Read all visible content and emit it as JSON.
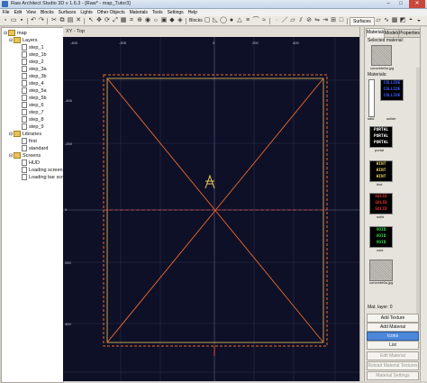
{
  "window": {
    "title": "Raw Architect Studio 3D v 1.6.3 - [Raw* - map_Tutor3]",
    "minimize": "–",
    "maximize": "□",
    "close": "✕"
  },
  "menu": [
    "File",
    "Edit",
    "View",
    "Blocks",
    "Surfaces",
    "Lights",
    "Other Objects",
    "Materials",
    "Tools",
    "Settings",
    "Help"
  ],
  "toolbar": {
    "blocks_label": "Blocks",
    "surfaces_label": "Surfaces"
  },
  "tree": {
    "root": "map",
    "layers_label": "Layers",
    "layers": [
      "step_1",
      "step_1b",
      "step_2",
      "step_3a",
      "step_3b",
      "step_4",
      "step_5a",
      "step_5b",
      "step_6",
      "step_7",
      "step_8",
      "step_9"
    ],
    "libraries_label": "Libraries",
    "libraries": [
      "first",
      "standard"
    ],
    "screens_label": "Screens",
    "screens": [
      "HUD",
      "Loading screen",
      "Loading bar screen"
    ]
  },
  "viewport": {
    "label": "XY - Top",
    "top_ticks": [
      "-400",
      "-200",
      "0",
      "200",
      "400"
    ],
    "left_ticks": [
      "-400",
      "-200",
      "0",
      "200",
      "400"
    ]
  },
  "panel": {
    "tabs": [
      "Materials",
      "Models",
      "Properties"
    ],
    "selected_material_label": "Selected material:",
    "selected_material_name": "concrete6a.jpg",
    "materials_label": "Materials:",
    "materials": [
      {
        "name": "sdid"
      },
      {
        "name": "solide",
        "lines": [
          "COLLIDE",
          "COLLIDE",
          "COLLIDE"
        ],
        "bg": "#000000",
        "fg": "#3a5cff"
      },
      {
        "name": "portal",
        "lines": [
          "PORTAL",
          "PORTAL",
          "PORTAL"
        ],
        "bg": "#000000",
        "fg": "#ffffff"
      },
      {
        "name": "hint",
        "lines": [
          "HINT",
          "HINT",
          "HINT"
        ],
        "bg": "#000000",
        "fg": "#e8d35a"
      },
      {
        "name": "solid",
        "lines": [
          "SOLID",
          "SOLID",
          "SOLID"
        ],
        "bg": "#000000",
        "fg": "#e03030"
      },
      {
        "name": "void",
        "lines": [
          "VOID",
          "VOID",
          "VOID"
        ],
        "bg": "#000000",
        "fg": "#31d648"
      },
      {
        "name": "concrete6a.jpg"
      }
    ],
    "mat_layer_label": "Mat. layer:",
    "mat_layer_value": "0",
    "buttons": [
      {
        "label": "Add Texture",
        "state": "normal"
      },
      {
        "label": "Add Material",
        "state": "normal"
      },
      {
        "label": "Icons",
        "state": "selected"
      },
      {
        "label": "List",
        "state": "normal"
      },
      {
        "label": "Edit Material",
        "state": "disabled"
      },
      {
        "label": "Reload Material Textures",
        "state": "disabled"
      },
      {
        "label": "Material Settings",
        "state": "disabled"
      }
    ]
  },
  "colors": {
    "viewport_bg": "#0e1027",
    "block_outline": "#f06a2a",
    "block_inner": "#f0c95a",
    "axis": "#e84a4a"
  }
}
